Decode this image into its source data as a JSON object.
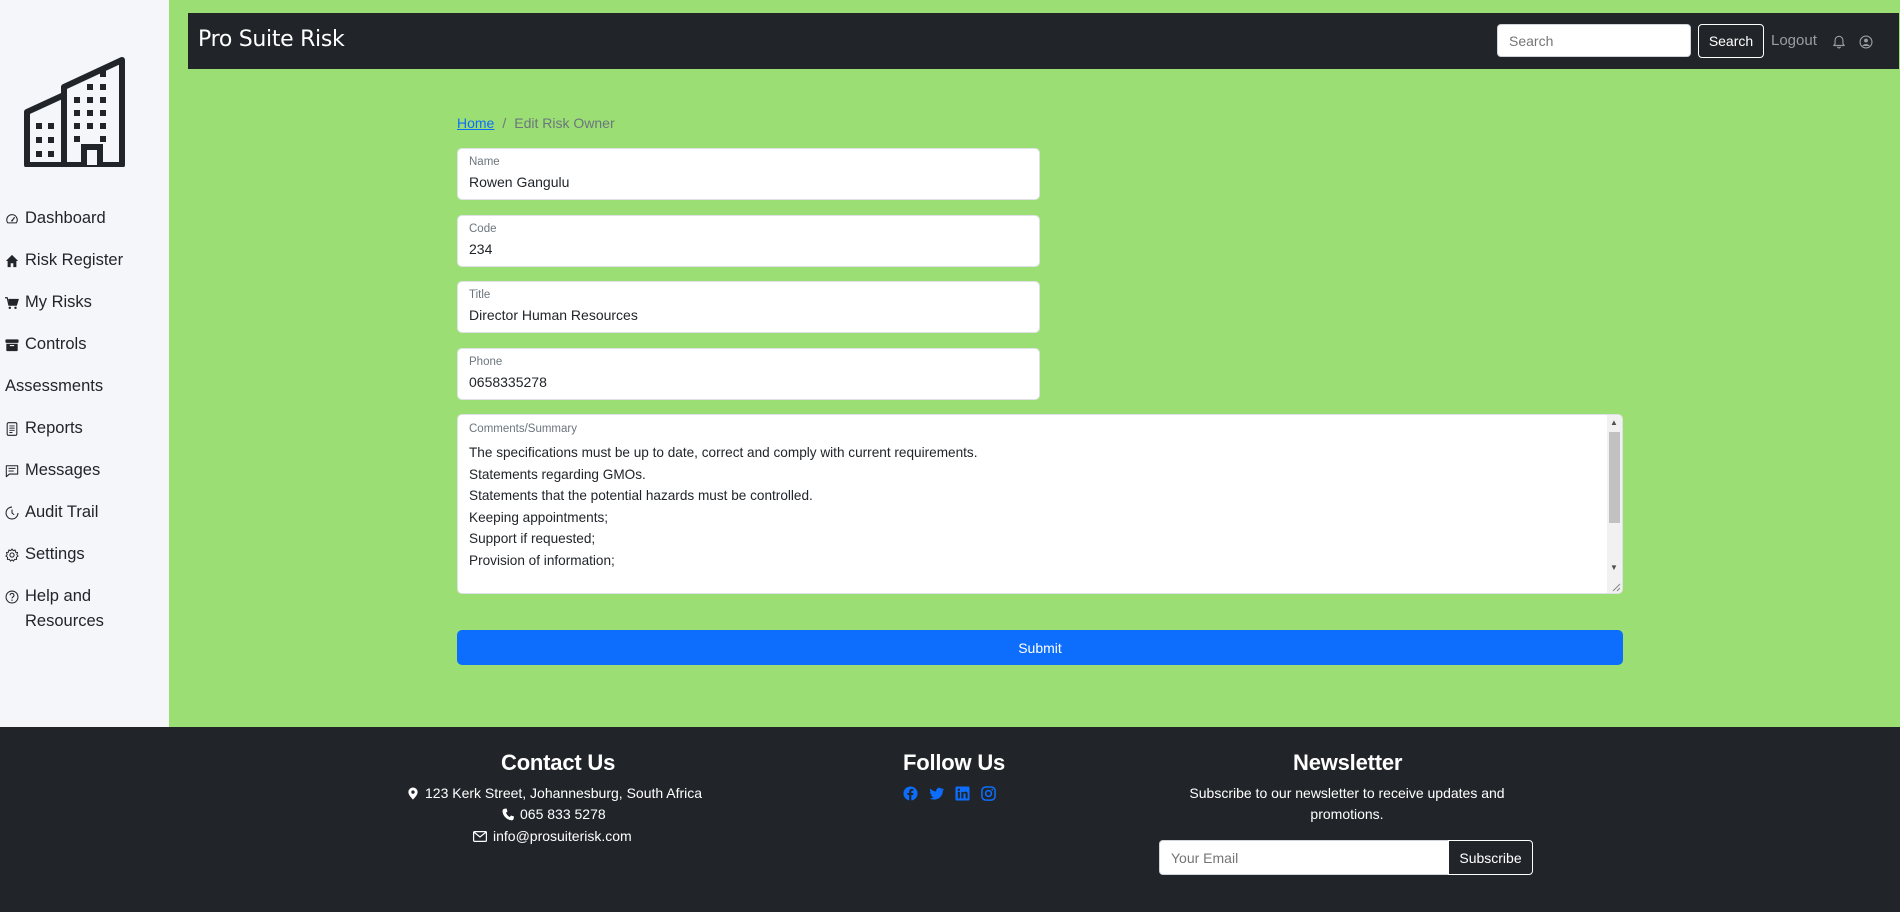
{
  "sidebar": {
    "logo": "building-logo",
    "items": [
      {
        "label": "Dashboard",
        "icon": "speedometer-icon"
      },
      {
        "label": "Risk Register",
        "icon": "house-icon"
      },
      {
        "label": "My Risks",
        "icon": "cart-icon"
      },
      {
        "label": "Controls",
        "icon": "archive-icon"
      },
      {
        "label": "Assessments",
        "icon": ""
      },
      {
        "label": "Reports",
        "icon": "file-text-icon"
      },
      {
        "label": "Messages",
        "icon": "chat-icon"
      },
      {
        "label": "Audit Trail",
        "icon": "clock-icon"
      },
      {
        "label": "Settings",
        "icon": "gear-icon"
      },
      {
        "label": "Help and Resources",
        "icon": "question-circle-icon"
      }
    ]
  },
  "topbar": {
    "brand": "Pro Suite Risk",
    "search_placeholder": "Search",
    "search_button": "Search",
    "logout": "Logout"
  },
  "breadcrumb": {
    "home": "Home",
    "separator": "/",
    "current": "Edit Risk Owner"
  },
  "form": {
    "name": {
      "label": "Name",
      "value": "Rowen Gangulu"
    },
    "code": {
      "label": "Code",
      "value": "234"
    },
    "title": {
      "label": "Title",
      "value": "Director Human Resources"
    },
    "phone": {
      "label": "Phone",
      "value": "0658335278"
    },
    "comments": {
      "label": "Comments/Summary",
      "lines": [
        "The specifications must be up to date, correct and comply with current requirements.",
        "Statements regarding GMOs.",
        "Statements that the potential hazards must be controlled.",
        "Keeping appointments;",
        "Support if requested;",
        "Provision of information;"
      ]
    },
    "submit": "Submit"
  },
  "footer": {
    "contact": {
      "title": "Contact Us",
      "address": "123 Kerk Street, Johannesburg, South Africa",
      "phone": "065 833 5278",
      "email": "info@prosuiterisk.com"
    },
    "follow": {
      "title": "Follow Us",
      "icons": [
        "facebook-icon",
        "twitter-icon",
        "linkedin-icon",
        "instagram-icon"
      ]
    },
    "newsletter": {
      "title": "Newsletter",
      "text": "Subscribe to our newsletter to receive updates and promotions.",
      "placeholder": "Your Email",
      "button": "Subscribe"
    }
  },
  "colors": {
    "page_bg": "#9bdf74",
    "dark": "#212529",
    "primary": "#0d6efd",
    "sidebar_bg": "#f5f6fa"
  }
}
